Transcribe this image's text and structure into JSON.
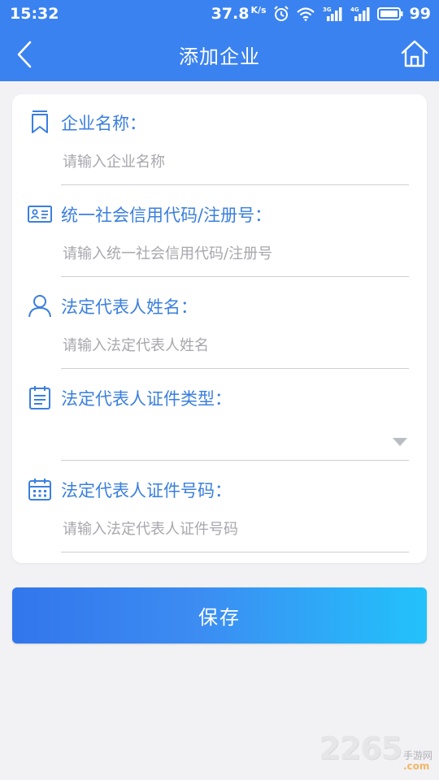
{
  "status_bar": {
    "time": "15:32",
    "net_speed": "37.8",
    "net_speed_unit": "K/s",
    "network_a": "3G",
    "network_b": "4G",
    "battery": "99"
  },
  "header": {
    "title": "添加企业",
    "back_icon": "chevron-left-icon",
    "home_icon": "home-icon"
  },
  "form": {
    "fields": [
      {
        "icon": "bookmark-icon",
        "label": "企业名称：",
        "placeholder": "请输入企业名称",
        "value": ""
      },
      {
        "icon": "id-card-icon",
        "label": "统一社会信用代码/注册号：",
        "placeholder": "请输入统一社会信用代码/注册号",
        "value": ""
      },
      {
        "icon": "person-icon",
        "label": "法定代表人姓名：",
        "placeholder": "请输入法定代表人姓名",
        "value": ""
      },
      {
        "icon": "clipboard-list-icon",
        "label": "法定代表人证件类型：",
        "selected": ""
      },
      {
        "icon": "calendar-icon",
        "label": "法定代表人证件号码：",
        "placeholder": "请输入法定代表人证件号码",
        "value": ""
      }
    ]
  },
  "actions": {
    "save_label": "保存"
  },
  "watermark": {
    "number": "2265",
    "text": "手游网",
    "domain": ".com"
  },
  "colors": {
    "header_bg": "#3a82f0",
    "label": "#3a7fde",
    "button_start": "#3276ec",
    "button_end": "#22c2fb",
    "page_bg": "#f2f2f4"
  }
}
